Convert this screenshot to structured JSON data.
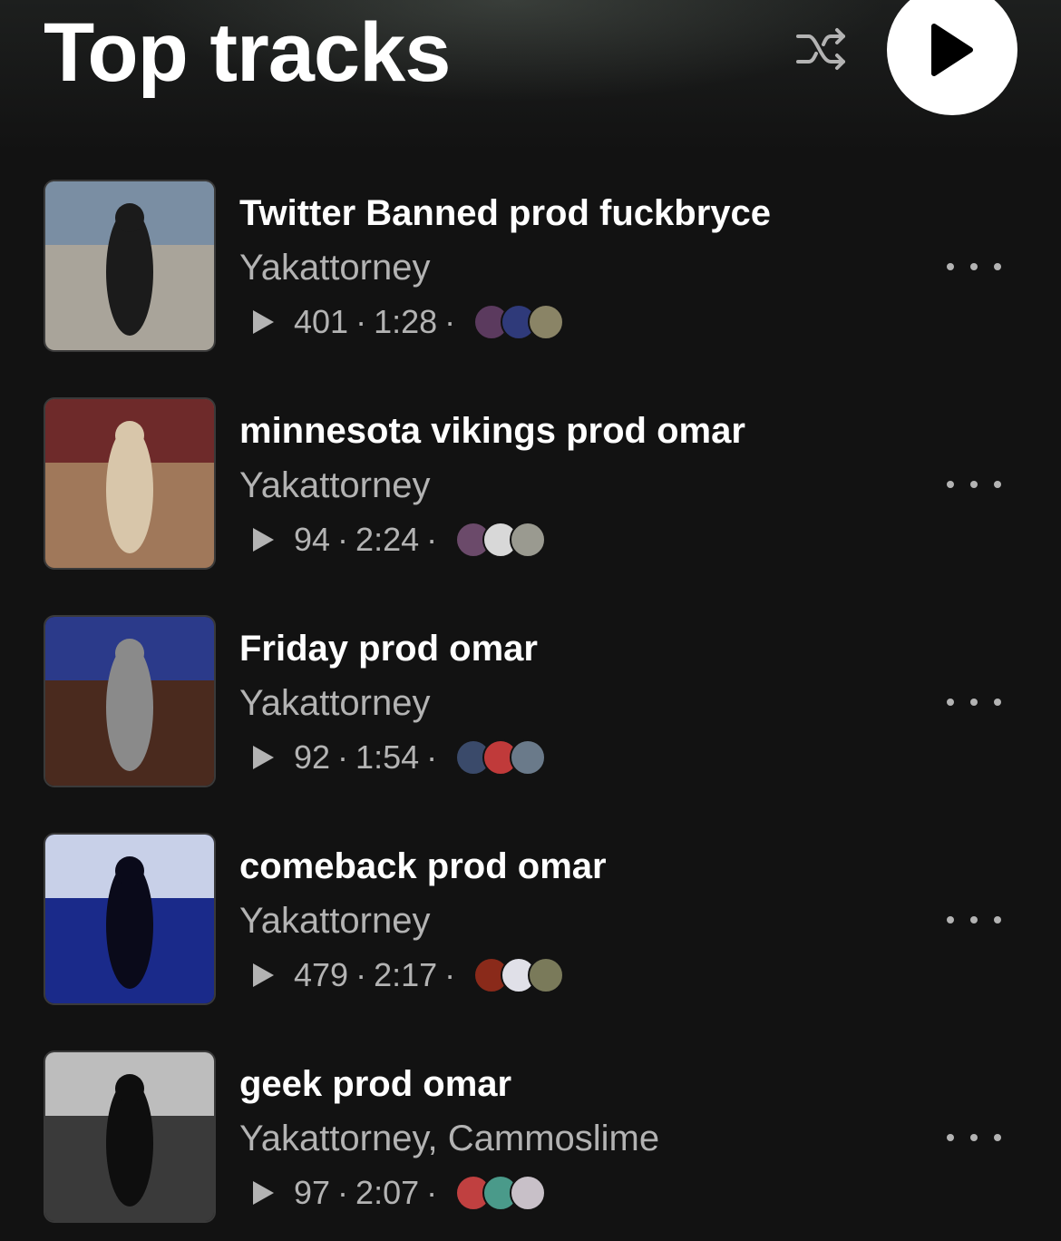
{
  "header": {
    "title": "Top tracks",
    "shuffle_icon": "shuffle-icon",
    "play_icon": "play-icon"
  },
  "colors": {
    "background": "#121212",
    "primary_text": "#ffffff",
    "secondary_text": "#b3b3b3",
    "play_button_bg": "#ffffff"
  },
  "tracks": [
    {
      "title": "Twitter Banned prod fuckbryce",
      "artist": "Yakattorney",
      "plays": "401",
      "duration": "1:28",
      "sep1": "·",
      "sep2": "·",
      "art_colors": [
        "#a9a49a",
        "#7a8ea3",
        "#1b1b1b"
      ],
      "avatar_colors": [
        "#5b3a5e",
        "#2f3a7a",
        "#8a8466"
      ]
    },
    {
      "title": "minnesota vikings prod omar",
      "artist": "Yakattorney",
      "plays": "94",
      "duration": "2:24",
      "sep1": "·",
      "sep2": "·",
      "art_colors": [
        "#a0785a",
        "#6e2a2a",
        "#d8c6aa"
      ],
      "avatar_colors": [
        "#6b4a6a",
        "#d8d8d8",
        "#9a9a90"
      ]
    },
    {
      "title": "Friday prod omar",
      "artist": "Yakattorney",
      "plays": "92",
      "duration": "1:54",
      "sep1": "·",
      "sep2": "·",
      "art_colors": [
        "#4a2a1e",
        "#2b3a8a",
        "#8a8a8a"
      ],
      "avatar_colors": [
        "#3a4a6a",
        "#c03a3a",
        "#6a7a8a"
      ]
    },
    {
      "title": "comeback prod omar",
      "artist": "Yakattorney",
      "plays": "479",
      "duration": "2:17",
      "sep1": "·",
      "sep2": "·",
      "art_colors": [
        "#1a2a8a",
        "#c8d0e8",
        "#0a0a1a"
      ],
      "avatar_colors": [
        "#8a2a1a",
        "#e0e0e8",
        "#7a7a5a"
      ]
    },
    {
      "title": "geek prod omar",
      "artist": "Yakattorney, Cammoslime",
      "plays": "97",
      "duration": "2:07",
      "sep1": "·",
      "sep2": "·",
      "art_colors": [
        "#3a3a3a",
        "#bdbdbd",
        "#0e0e0e"
      ],
      "avatar_colors": [
        "#c04040",
        "#4a9a8a",
        "#c8c0c8"
      ]
    }
  ]
}
